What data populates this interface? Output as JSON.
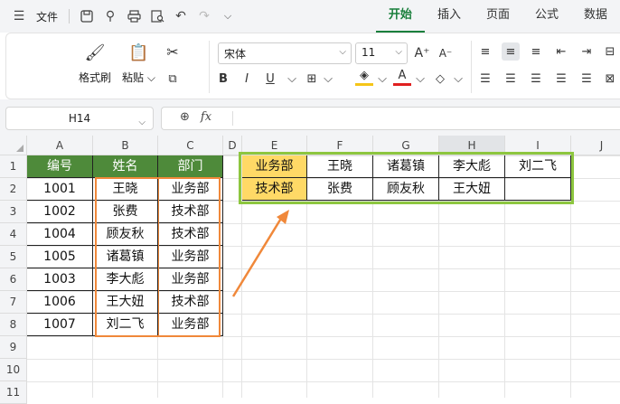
{
  "menubar": {
    "file_label": "文件",
    "tabs": [
      {
        "label": "开始",
        "active": true
      },
      {
        "label": "插入",
        "active": false
      },
      {
        "label": "页面",
        "active": false
      },
      {
        "label": "公式",
        "active": false
      },
      {
        "label": "数据",
        "active": false
      }
    ]
  },
  "ribbon": {
    "format_painter_label": "格式刷",
    "paste_label": "粘贴",
    "font_name": "宋体",
    "font_size": "11"
  },
  "formula_bar": {
    "name_box": "H14",
    "fx_label": "fx",
    "formula_value": ""
  },
  "columns": [
    "A",
    "B",
    "C",
    "D",
    "E",
    "F",
    "G",
    "H",
    "I",
    "J"
  ],
  "rows": [
    "1",
    "2",
    "3",
    "4",
    "5",
    "6",
    "7",
    "8",
    "9",
    "10",
    "11"
  ],
  "selected_column": "H",
  "source_table": {
    "headers": [
      "编号",
      "姓名",
      "部门"
    ],
    "rows": [
      [
        "1001",
        "王晓",
        "业务部"
      ],
      [
        "1002",
        "张费",
        "技术部"
      ],
      [
        "1004",
        "顾友秋",
        "技术部"
      ],
      [
        "1005",
        "诸葛镇",
        "业务部"
      ],
      [
        "1003",
        "李大彪",
        "业务部"
      ],
      [
        "1006",
        "王大妞",
        "技术部"
      ],
      [
        "1007",
        "刘二飞",
        "业务部"
      ]
    ]
  },
  "result_table": {
    "rows": [
      [
        "业务部",
        "王晓",
        "诸葛镇",
        "李大彪",
        "刘二飞"
      ],
      [
        "技术部",
        "张费",
        "顾友秋",
        "王大妞",
        ""
      ]
    ]
  },
  "colors": {
    "header_green": "#4e8a3a",
    "highlight_yellow": "#ffd966",
    "orange_outline": "#f0883a",
    "green_outline": "#8dc63f",
    "active_tab": "#1a7f3c"
  }
}
